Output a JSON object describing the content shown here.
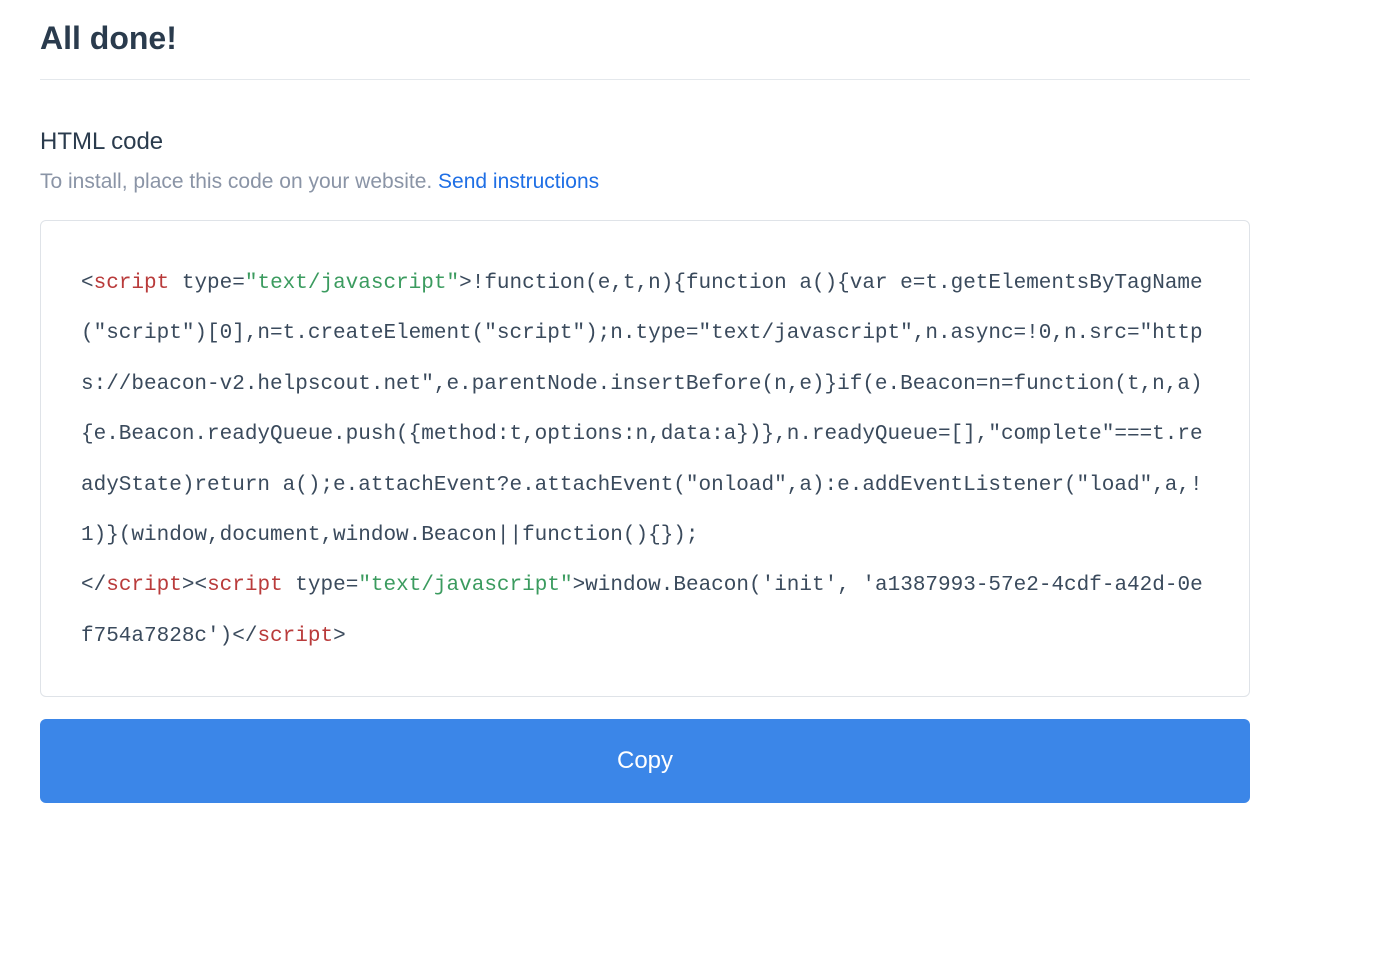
{
  "header": {
    "title": "All done!"
  },
  "section": {
    "title": "HTML code",
    "instructions_prefix": "To install, place this code on your website. ",
    "instructions_link": "Send instructions"
  },
  "code": {
    "open_tag_name": "script",
    "type_attr": " type=",
    "type_value": "\"text/javascript\"",
    "body1": ">!function(e,t,n){function a(){var e=t.getElementsByTagName(\"script\")[0],n=t.createElement(\"script\");n.type=\"text/javascript\",n.async=!0,n.src=\"https://beacon-v2.helpscout.net\",e.parentNode.insertBefore(n,e)}if(e.Beacon=n=function(t,n,a){e.Beacon.readyQueue.push({method:t,options:n,data:a})},n.readyQueue=[],\"complete\"===t.readyState)return a();e.attachEvent?e.attachEvent(\"onload\",a):e.addEventListener(\"load\",a,!1)}(window,document,window.Beacon||function(){});\n",
    "close_tag_name": "script",
    "open_tag_name2": "script",
    "type_attr2": " type=",
    "type_value2": "\"text/javascript\"",
    "body2": ">window.Beacon('init', 'a1387993-57e2-4cdf-a42d-0ef754a7828c')",
    "close_tag_name2": "script"
  },
  "actions": {
    "copy_label": "Copy"
  }
}
